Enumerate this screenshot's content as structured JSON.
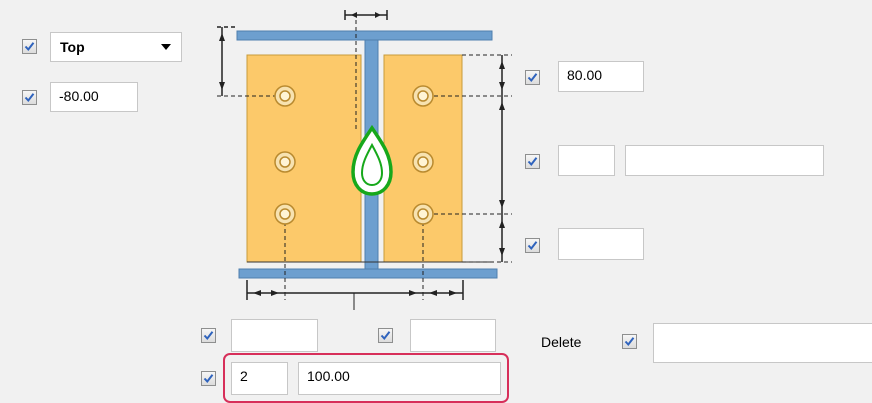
{
  "position_select": {
    "value": "Top"
  },
  "top_offset": {
    "value": "-80.00"
  },
  "right_fields": {
    "top_spacing": "80.00",
    "middle_count": "",
    "middle_spacing": "",
    "bottom_spacing": ""
  },
  "bottom_fields": {
    "left_edge": "",
    "right_edge": "",
    "bolt_count": "2",
    "bolt_spacing": "100.00"
  },
  "delete": {
    "label": "Delete",
    "value": ""
  },
  "icons": {
    "checkbox": "checkmark-icon",
    "dropdown": "chevron-down-icon",
    "diagram": "steel-beam-bolt-diagram",
    "bolt": "bolt-icon",
    "marker": "green-drop-marker-icon"
  },
  "colors": {
    "plate": "#fcc96a",
    "steel": "#6d9fcf",
    "steel_edge": "#4f7fae",
    "marker": "#17a81b",
    "highlight": "#d72f5a",
    "check": "#2f63bd"
  }
}
